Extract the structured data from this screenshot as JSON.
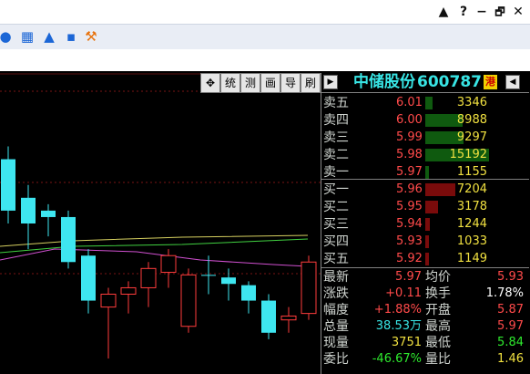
{
  "window": {
    "controls": [
      "▲",
      "?",
      "−",
      "🗗",
      "✕"
    ]
  },
  "toolbar": {
    "icons": [
      "mic-icon",
      "keyboard-icon",
      "shirt-icon",
      "grid-icon",
      "tool-icon"
    ]
  },
  "chart_toolbar": [
    "✥",
    "统",
    "测",
    "画",
    "导",
    "刷"
  ],
  "stock": {
    "left_arrow": "▶",
    "name": "中储股份",
    "code": "600787",
    "badge": "港",
    "right_arrow": "◀"
  },
  "sell": [
    {
      "label": "卖五",
      "price": "6.01",
      "vol": "3346",
      "bar": 0.12
    },
    {
      "label": "卖四",
      "price": "6.00",
      "vol": "8988",
      "bar": 0.58
    },
    {
      "label": "卖三",
      "price": "5.99",
      "vol": "9297",
      "bar": 0.6
    },
    {
      "label": "卖二",
      "price": "5.98",
      "vol": "15192",
      "bar": 1.0
    },
    {
      "label": "卖一",
      "price": "5.97",
      "vol": "1155",
      "bar": 0.05
    }
  ],
  "buy": [
    {
      "label": "买一",
      "price": "5.96",
      "vol": "7204",
      "bar": 0.47
    },
    {
      "label": "买二",
      "price": "5.95",
      "vol": "3178",
      "bar": 0.2
    },
    {
      "label": "买三",
      "price": "5.94",
      "vol": "1244",
      "bar": 0.07
    },
    {
      "label": "买四",
      "price": "5.93",
      "vol": "1033",
      "bar": 0.06
    },
    {
      "label": "买五",
      "price": "5.92",
      "vol": "1149",
      "bar": 0.06
    }
  ],
  "stats": [
    {
      "l1": "最新",
      "v1": "5.97",
      "c1": "red",
      "l2": "均价",
      "v2": "5.93",
      "c2": "red"
    },
    {
      "l1": "涨跌",
      "v1": "+0.11",
      "c1": "red",
      "l2": "换手",
      "v2": "1.78%",
      "c2": "white"
    },
    {
      "l1": "幅度",
      "v1": "+1.88%",
      "c1": "red",
      "l2": "开盘",
      "v2": "5.87",
      "c2": "red"
    },
    {
      "l1": "总量",
      "v1": "38.53万",
      "c1": "cyan",
      "l2": "最高",
      "v2": "5.97",
      "c2": "red"
    },
    {
      "l1": "现量",
      "v1": "3751",
      "c1": "yellow",
      "l2": "最低",
      "v2": "5.84",
      "c2": "green"
    },
    {
      "l1": "委比",
      "v1": "-46.67%",
      "c1": "green",
      "l2": "量比",
      "v2": "1.46",
      "c2": "yellow"
    }
  ],
  "candles": [
    {
      "o": 5.6,
      "c": 5.2,
      "h": 5.7,
      "l": 5.1
    },
    {
      "o": 5.3,
      "c": 5.1,
      "h": 5.4,
      "l": 4.9
    },
    {
      "o": 5.2,
      "c": 5.15,
      "h": 5.25,
      "l": 5.0
    },
    {
      "o": 5.15,
      "c": 4.8,
      "h": 5.2,
      "l": 4.75
    },
    {
      "o": 4.85,
      "c": 4.5,
      "h": 4.9,
      "l": 4.4
    },
    {
      "o": 4.45,
      "c": 4.55,
      "h": 4.6,
      "l": 4.05
    },
    {
      "o": 4.55,
      "c": 4.6,
      "h": 4.65,
      "l": 4.4
    },
    {
      "o": 4.6,
      "c": 4.75,
      "h": 4.8,
      "l": 4.45
    },
    {
      "o": 4.72,
      "c": 4.85,
      "h": 4.9,
      "l": 4.6
    },
    {
      "o": 4.3,
      "c": 4.7,
      "h": 4.75,
      "l": 4.25
    },
    {
      "o": 4.7,
      "c": 4.7,
      "h": 4.85,
      "l": 4.55
    },
    {
      "o": 4.68,
      "c": 4.63,
      "h": 4.75,
      "l": 4.5
    },
    {
      "o": 4.62,
      "c": 4.5,
      "h": 4.65,
      "l": 4.4
    },
    {
      "o": 4.5,
      "c": 4.25,
      "h": 4.55,
      "l": 4.2
    },
    {
      "o": 4.35,
      "c": 4.38,
      "h": 4.45,
      "l": 4.25
    },
    {
      "o": 4.4,
      "c": 4.8,
      "h": 4.85,
      "l": 4.35
    }
  ]
}
